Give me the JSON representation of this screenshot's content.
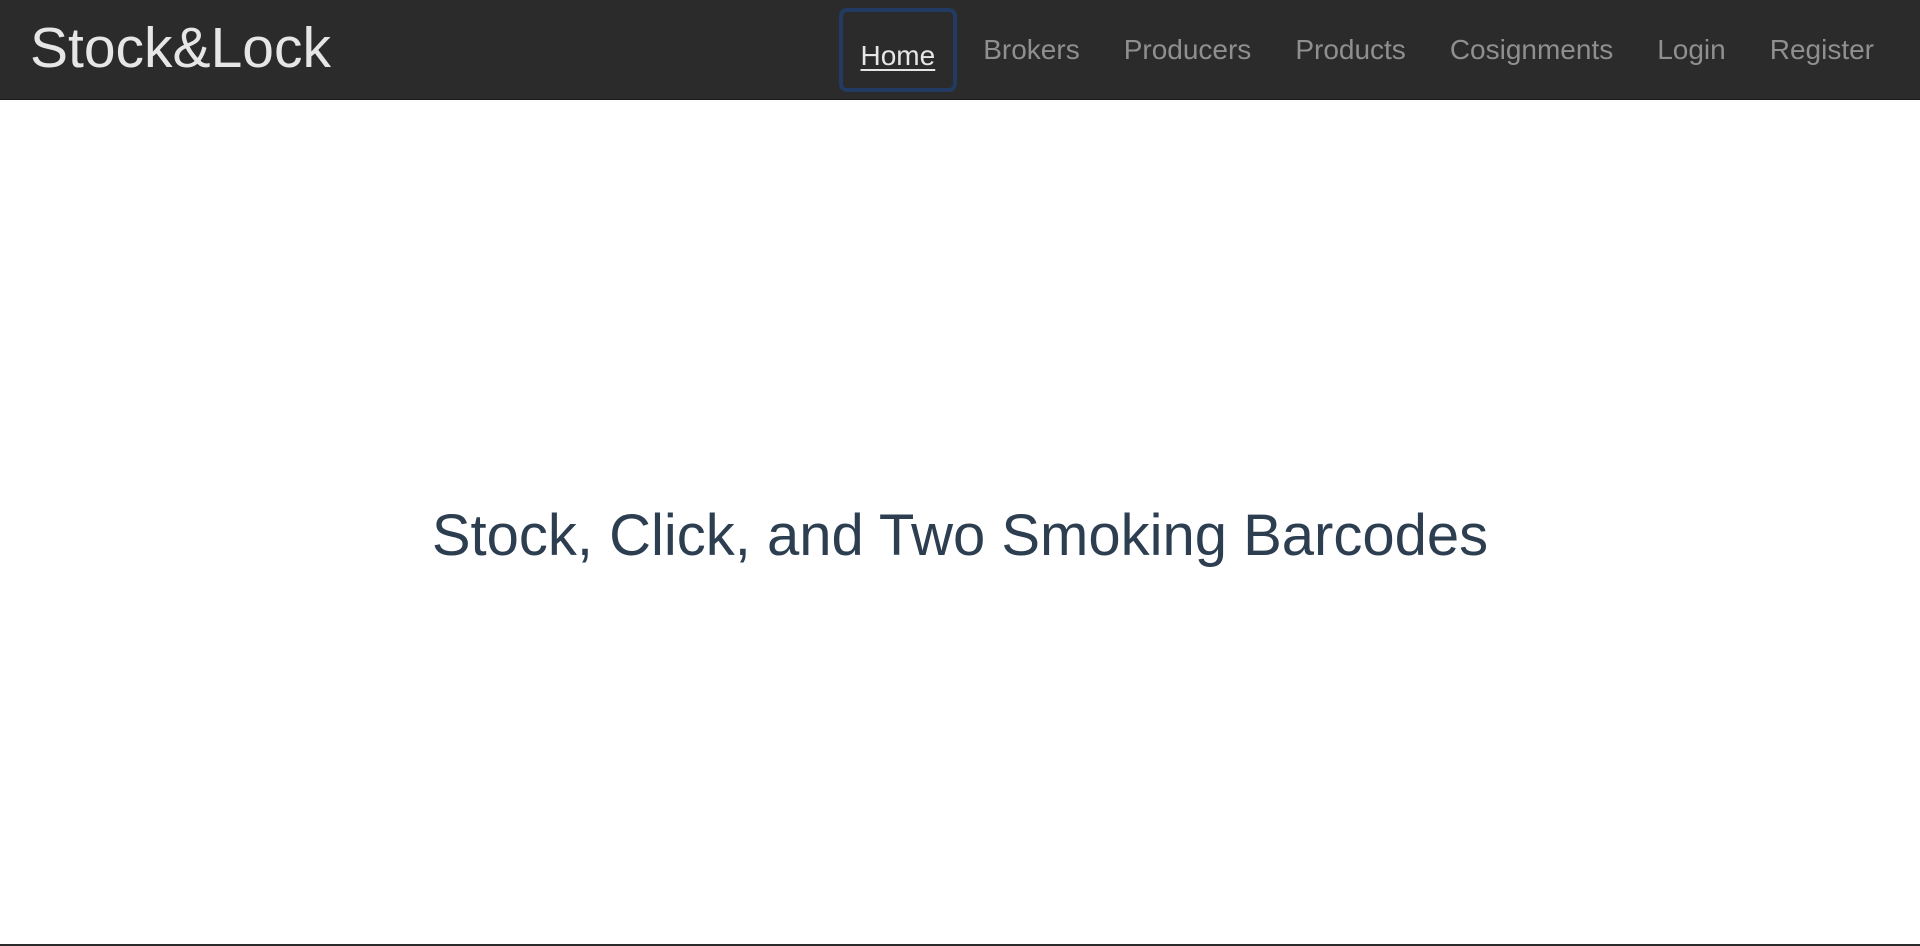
{
  "navbar": {
    "brand": "Stock&Lock",
    "items": [
      {
        "label": "Home",
        "active": true
      },
      {
        "label": "Brokers",
        "active": false
      },
      {
        "label": "Producers",
        "active": false
      },
      {
        "label": "Products",
        "active": false
      },
      {
        "label": "Cosignments",
        "active": false
      },
      {
        "label": "Login",
        "active": false
      },
      {
        "label": "Register",
        "active": false
      }
    ]
  },
  "main": {
    "headline": "Stock, Click, and Two Smoking Barcodes"
  },
  "colors": {
    "navbar_bg": "#2b2b2b",
    "brand_text": "#e6e6e6",
    "nav_link": "#8f8f8f",
    "focus_ring": "#233b63",
    "headline_text": "#2c3e50"
  }
}
